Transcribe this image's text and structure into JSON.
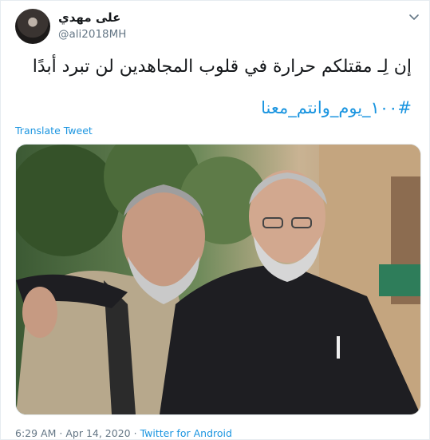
{
  "tweet": {
    "author_name": "على مهدي",
    "author_handle": "@ali2018MH",
    "text": "إن لِـ مقتلكم حرارة في قلوب المجاهدين لن تبرد أبدًا",
    "hashtag": "#١٠٠_يوم_وانتم_معنا",
    "translate_label": "Translate Tweet",
    "time": "6:29 AM",
    "separator": "·",
    "date": "Apr 14, 2020",
    "source": "Twitter for Android"
  },
  "icons": {
    "more": "chevron-down-icon",
    "avatar": "avatar",
    "photo": "tweet-photo"
  },
  "colors": {
    "link": "#1b95e0",
    "muted": "#657786",
    "text": "#14171a"
  }
}
